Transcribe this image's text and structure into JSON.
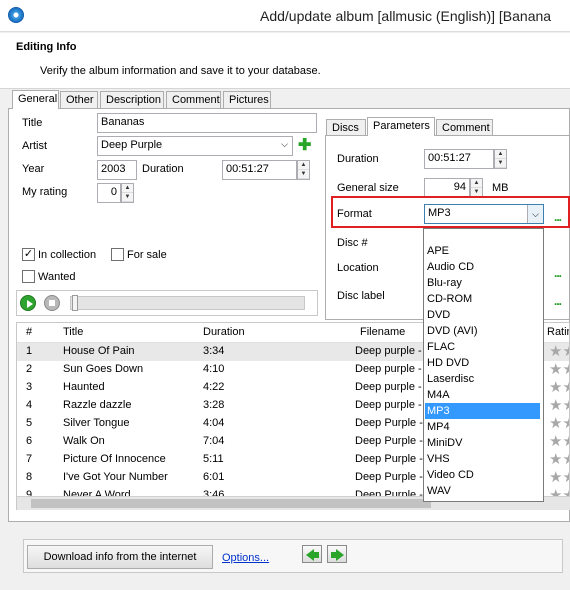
{
  "window": {
    "title": "Add/update album [allmusic (English)] [Banana"
  },
  "header": {
    "title": "Editing Info",
    "subtitle": "Verify the album information and save it to your database."
  },
  "tabs": [
    "General",
    "Other",
    "Description",
    "Comment",
    "Pictures"
  ],
  "general": {
    "title_label": "Title",
    "title_value": "Bananas",
    "artist_label": "Artist",
    "artist_value": "Deep Purple",
    "year_label": "Year",
    "year_value": "2003",
    "duration_label": "Duration",
    "duration_value": "00:51:27",
    "rating_label": "My rating",
    "rating_value": "0",
    "in_collection_label": "In collection",
    "in_collection_checked": true,
    "for_sale_label": "For sale",
    "for_sale_checked": false,
    "wanted_label": "Wanted",
    "wanted_checked": false
  },
  "inner_tabs": [
    "Discs",
    "Parameters",
    "Comment"
  ],
  "parameters": {
    "duration_label": "Duration",
    "duration_value": "00:51:27",
    "size_label": "General size",
    "size_value": "94",
    "size_unit": "MB",
    "format_label": "Format",
    "format_value": "MP3",
    "disc_label": "Disc #",
    "location_label": "Location",
    "disc_label_label": "Disc label",
    "dots": "..."
  },
  "format_options": [
    "APE",
    "Audio CD",
    "Blu-ray",
    "CD-ROM",
    "DVD",
    "DVD (AVI)",
    "FLAC",
    "HD DVD",
    "Laserdisc",
    "M4A",
    "MP3",
    "MP4",
    "MiniDV",
    "VHS",
    "Video CD",
    "WAV"
  ],
  "format_selected_index": 10,
  "tracks": {
    "columns": [
      "#",
      "Title",
      "Duration",
      "Filename",
      "Ratin"
    ],
    "rows": [
      {
        "n": "1",
        "title": "House Of Pain",
        "duration": "3:34",
        "file": "Deep purple -"
      },
      {
        "n": "2",
        "title": "Sun Goes Down",
        "duration": "4:10",
        "file": "Deep purple -"
      },
      {
        "n": "3",
        "title": "Haunted",
        "duration": "4:22",
        "file": "Deep purple -"
      },
      {
        "n": "4",
        "title": "Razzle dazzle",
        "duration": "3:28",
        "file": "Deep purple -"
      },
      {
        "n": "5",
        "title": "Silver Tongue",
        "duration": "4:04",
        "file": "Deep Purple -"
      },
      {
        "n": "6",
        "title": "Walk On",
        "duration": "7:04",
        "file": "Deep Purple -"
      },
      {
        "n": "7",
        "title": "Picture Of Innocence",
        "duration": "5:11",
        "file": "Deep Purple -"
      },
      {
        "n": "8",
        "title": "I've Got Your Number",
        "duration": "6:01",
        "file": "Deep Purple -"
      },
      {
        "n": "9",
        "title": "Never A Word",
        "duration": "3:46",
        "file": "Deep Purple -"
      }
    ]
  },
  "footer": {
    "download_label": "Download info from the internet",
    "options_label": "Options..."
  },
  "colors": {
    "selection": "#3399ff",
    "highlight_border": "#e02020",
    "accent_green": "#2aa52a"
  }
}
